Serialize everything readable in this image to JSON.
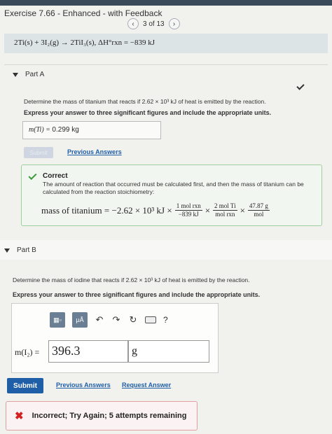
{
  "header": {
    "title": "Exercise 7.66 - Enhanced - with Feedback",
    "pager": "3 of 13"
  },
  "reaction": {
    "equation": "2Ti(s) + 3I₂(g) → 2TiI₃(s),   ΔH°rxn = −839 kJ"
  },
  "partA": {
    "label": "Part A",
    "question": "Determine the mass of titanium that reacts if 2.62 × 10³ kJ of heat is emitted by the reaction.",
    "instruction": "Express your answer to three significant figures and include the appropriate units.",
    "answer_label": "m(Ti) = ",
    "answer_value": "0.299 kg",
    "submit_label": "Submit",
    "previous_answers_label": "Previous Answers",
    "feedback": {
      "heading": "Correct",
      "text": "The amount of reaction that occurred must be calculated first, and then the mass of titanium can be calculated from the reaction stoichiometry:",
      "math_lhs": "mass of titanium = −2.62 × 10³ kJ ×",
      "f1_num": "1 mol rxn",
      "f1_den": "−839 kJ",
      "f2_num": "2 mol Ti",
      "f2_den": "mol rxn",
      "f3_num": "47.87 g",
      "f3_den": "mol",
      "times": "×"
    }
  },
  "partB": {
    "label": "Part B",
    "question": "Determine the mass of iodine that reacts if 2.62 × 10³ kJ of heat is emitted by the reaction.",
    "instruction": "Express your answer to three significant figures and include the appropriate units.",
    "answer_label": "m(I₂) =",
    "answer_value": "396.3",
    "unit_value": "g",
    "toolbar_units": "μÅ",
    "toolbar_help": "?",
    "submit_label": "Submit",
    "previous_answers_label": "Previous Answers",
    "request_answer_label": "Request Answer",
    "feedback": "Incorrect; Try Again; 5 attempts remaining"
  }
}
